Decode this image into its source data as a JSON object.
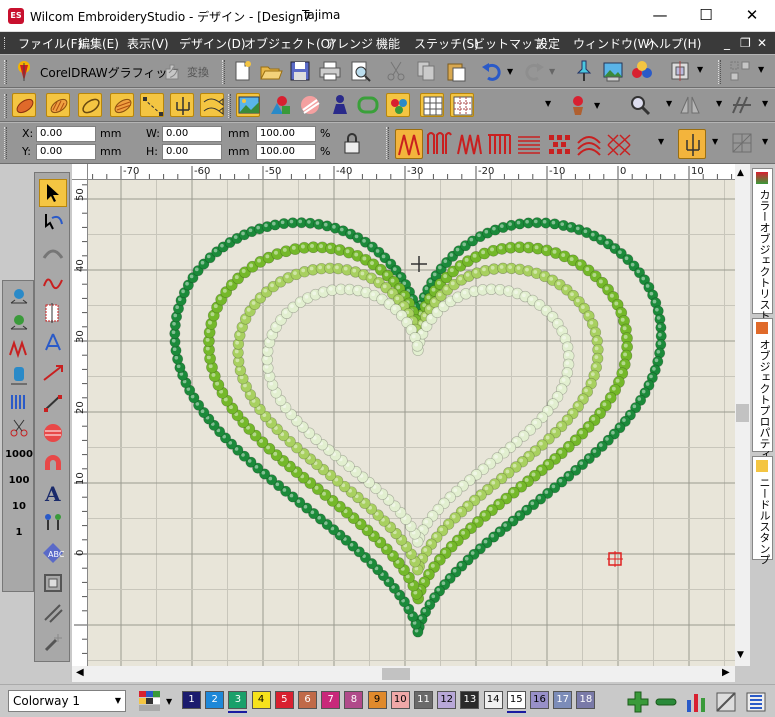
{
  "window": {
    "title": "Wilcom EmbroideryStudio - デザイン - [Design7",
    "machine": "Tajima",
    "app_icon": "ES",
    "minimize": "—",
    "maximize": "☐",
    "close": "✕"
  },
  "menu": [
    "ファイル(F)",
    "編集(E)",
    "表示(V)",
    "デザイン(D)",
    "オブジェクト(O)",
    "アレンジ",
    "機能",
    "ステッチ(S)",
    "ビットマップ",
    "設定",
    "ウィンドウ(W)",
    "ヘルプ(H)"
  ],
  "mdi": {
    "minimize": "_",
    "restore": "❐",
    "close": "✕"
  },
  "toolbar1": {
    "coreldraw_label": "CorelDRAWグラフィック",
    "convert_label": "変換"
  },
  "props": {
    "x_label": "X:",
    "x_value": "0.00",
    "y_label": "Y:",
    "y_value": "0.00",
    "w_label": "W:",
    "w_value": "0.00",
    "h_label": "H:",
    "h_value": "0.00",
    "unit": "mm",
    "sx_value": "100.00",
    "sy_value": "100.00",
    "pct": "%"
  },
  "ruler": {
    "h_ticks": [
      "-70",
      "-60",
      "-50",
      "-40",
      "-30",
      "-20",
      "-10",
      "0",
      "10"
    ],
    "v_ticks": [
      "50",
      "40",
      "30",
      "20",
      "10",
      "0"
    ]
  },
  "left_tools2": [
    "1000",
    "100",
    "10",
    "1"
  ],
  "right_tabs": [
    "カラーオブジェクトリスト",
    "オブジェクトプロパティ",
    "ニードルスタンプ"
  ],
  "colorway": {
    "label": "Colorway 1"
  },
  "swatches": [
    {
      "n": "1",
      "c": "#1b1b6e",
      "fg": "#fff"
    },
    {
      "n": "2",
      "c": "#1e88d8",
      "fg": "#fff"
    },
    {
      "n": "3",
      "c": "#1aa06a",
      "fg": "#fff"
    },
    {
      "n": "4",
      "c": "#f6e21c",
      "fg": "#000"
    },
    {
      "n": "5",
      "c": "#d82030",
      "fg": "#fff"
    },
    {
      "n": "6",
      "c": "#c06a48",
      "fg": "#fff"
    },
    {
      "n": "7",
      "c": "#c8287a",
      "fg": "#fff"
    },
    {
      "n": "8",
      "c": "#b04a8a",
      "fg": "#fff"
    },
    {
      "n": "9",
      "c": "#e08a2c",
      "fg": "#000"
    },
    {
      "n": "10",
      "c": "#f0a8a8",
      "fg": "#000"
    },
    {
      "n": "11",
      "c": "#6a6a6a",
      "fg": "#fff"
    },
    {
      "n": "12",
      "c": "#b8a8d8",
      "fg": "#000"
    },
    {
      "n": "13",
      "c": "#2a2a2a",
      "fg": "#fff"
    },
    {
      "n": "14",
      "c": "#f0f0f0",
      "fg": "#000"
    },
    {
      "n": "15",
      "c": "#ffffff",
      "fg": "#000"
    },
    {
      "n": "16",
      "c": "#9890c8",
      "fg": "#000"
    },
    {
      "n": "17",
      "c": "#7c8cb8",
      "fg": "#fff"
    },
    {
      "n": "18",
      "c": "#7a7aa8",
      "fg": "#fff"
    }
  ],
  "heart_colors": {
    "outer": "#1b8a3a",
    "second": "#74b82a",
    "third": "#a8d060",
    "inner": "#e2efd0"
  }
}
